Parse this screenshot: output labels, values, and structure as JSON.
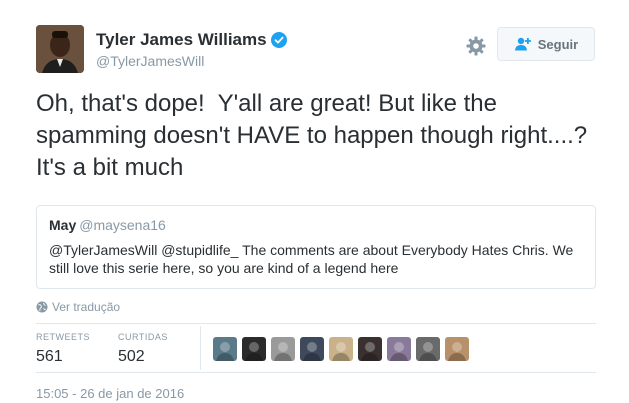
{
  "user": {
    "name": "Tyler James Williams",
    "handle": "@TylerJamesWill",
    "verified_icon": "verified-badge-icon"
  },
  "actions": {
    "settings_icon": "gear-icon",
    "follow_label": "Seguir",
    "follow_icon": "add-user-icon"
  },
  "tweet": {
    "text": "Oh, that's dope!  Y'all are great! But like the spamming doesn't HAVE to happen though right....? It's a bit much"
  },
  "quoted_tweet": {
    "name": "May",
    "handle": "@maysena16",
    "text": "@TylerJamesWill @stupidlife_ The comments are about Everybody Hates Chris. We still love this serie here, so you are kind of a legend here"
  },
  "translate_label": "Ver tradução",
  "stats": {
    "retweets_label": "RETWEETS",
    "retweets_count": "561",
    "likes_label": "CURTIDAS",
    "likes_count": "502"
  },
  "likers": [
    {
      "name": "liker-avatar-1",
      "color": "#5a7a8a"
    },
    {
      "name": "liker-avatar-2",
      "color": "#2b2b2b"
    },
    {
      "name": "liker-avatar-3",
      "color": "#9a9a9a"
    },
    {
      "name": "liker-avatar-4",
      "color": "#3e4a5c"
    },
    {
      "name": "liker-avatar-5",
      "color": "#c9b28a"
    },
    {
      "name": "liker-avatar-6",
      "color": "#3a3030"
    },
    {
      "name": "liker-avatar-7",
      "color": "#8a7a9a"
    },
    {
      "name": "liker-avatar-8",
      "color": "#6a6a6a"
    },
    {
      "name": "liker-avatar-9",
      "color": "#b8906a"
    }
  ],
  "timestamp": "15:05 - 26 de jan de 2016",
  "colors": {
    "verified": "#1da1f2",
    "muted": "#8899a6",
    "text": "#292f33",
    "border": "#e1e8ed"
  }
}
